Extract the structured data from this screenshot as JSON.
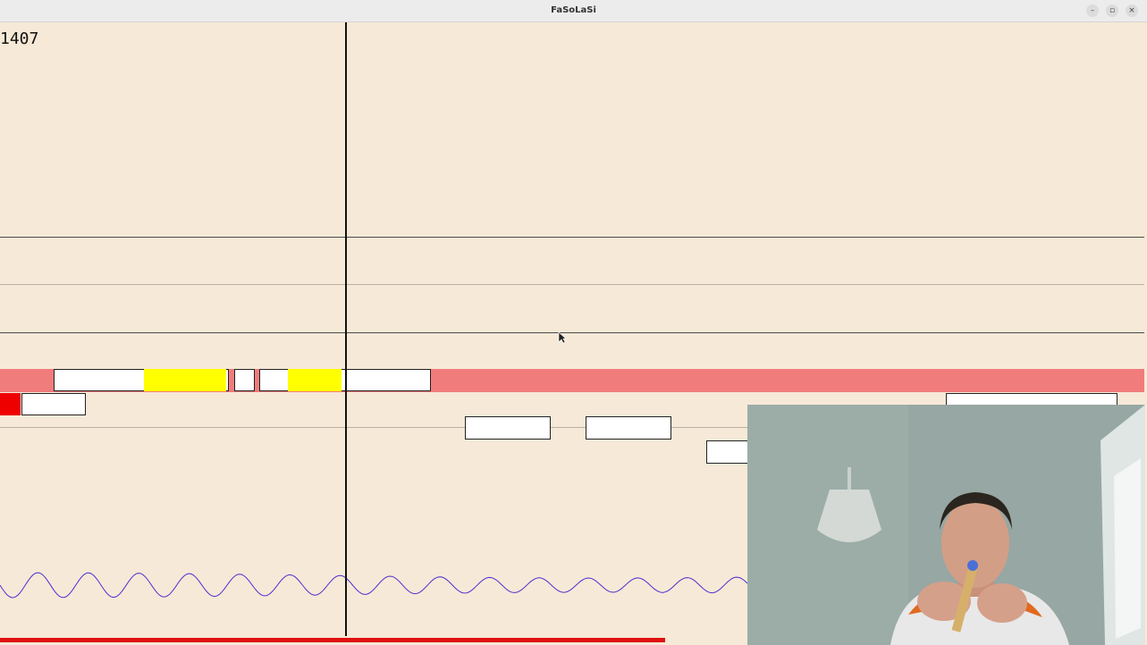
{
  "window": {
    "title": "FaSoLaSi",
    "minimize_label": "–",
    "restore_label": "▫",
    "close_label": "×"
  },
  "score": {
    "counter": "1407"
  },
  "playback": {
    "progress_percent": 58
  },
  "colors": {
    "background": "#f7e9d7",
    "active_band": "#f07c7c",
    "note_fill": "#ffffff",
    "note_hit": "#ffff00",
    "note_miss": "#ee0000",
    "waveform": "#4b2fd0",
    "progress": "#e01010"
  },
  "webcam": {
    "icon": "webcam-feed"
  }
}
